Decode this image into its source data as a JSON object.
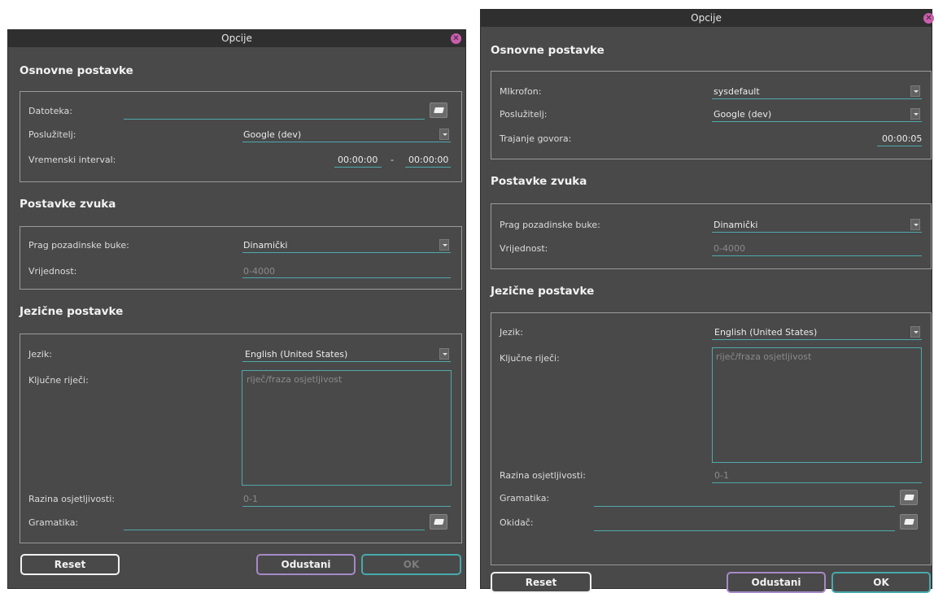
{
  "dialog_left": {
    "title": "Opcije",
    "basic": {
      "heading": "Osnovne postavke",
      "file_label": "Datoteka:",
      "server_label": "Poslužitelj:",
      "server_value": "Google (dev)",
      "interval_label": "Vremenski interval:",
      "interval_start": "00:00:00",
      "interval_sep": "-",
      "interval_end": "00:00:00"
    },
    "sound": {
      "heading": "Postavke zvuka",
      "noise_label": "Prag pozadinske buke:",
      "noise_value": "Dinamički",
      "value_label": "Vrijednost:",
      "value_placeholder": "0-4000"
    },
    "lang": {
      "heading": "Jezične postavke",
      "language_label": "Jezik:",
      "language_value": "English (United States)",
      "keywords_label": "Ključne riječi:",
      "keywords_placeholder": "riječ/fraza osjetljivost",
      "sens_label": "Razina osjetljivosti:",
      "sens_placeholder": "0-1",
      "grammar_label": "Gramatika:"
    },
    "buttons": {
      "reset": "Reset",
      "cancel": "Odustani",
      "ok": "OK"
    }
  },
  "dialog_right": {
    "title": "Opcije",
    "basic": {
      "heading": "Osnovne postavke",
      "mic_label": "MIkrofon:",
      "mic_value": "sysdefault",
      "server_label": "Poslužitelj:",
      "server_value": "Google (dev)",
      "duration_label": "Trajanje govora:",
      "duration_value": "00:00:05"
    },
    "sound": {
      "heading": "Postavke zvuka",
      "noise_label": "Prag pozadinske buke:",
      "noise_value": "Dinamički",
      "value_label": "Vrijednost:",
      "value_placeholder": "0-4000"
    },
    "lang": {
      "heading": "Jezične postavke",
      "language_label": "Jezik:",
      "language_value": "English (United States)",
      "keywords_label": "Ključne riječi:",
      "keywords_placeholder": "riječ/fraza osjetljivost",
      "sens_label": "Razina osjetljivosti:",
      "sens_placeholder": "0-1",
      "grammar_label": "Gramatika:",
      "trigger_label": "Okidač:"
    },
    "buttons": {
      "reset": "Reset",
      "cancel": "Odustani",
      "ok": "OK"
    }
  },
  "colors": {
    "accent": "#4fa9ac",
    "cancel": "#a58ac8",
    "close": "#ca5dad",
    "window_bg": "#494949",
    "titlebar": "#2f2f2f"
  }
}
